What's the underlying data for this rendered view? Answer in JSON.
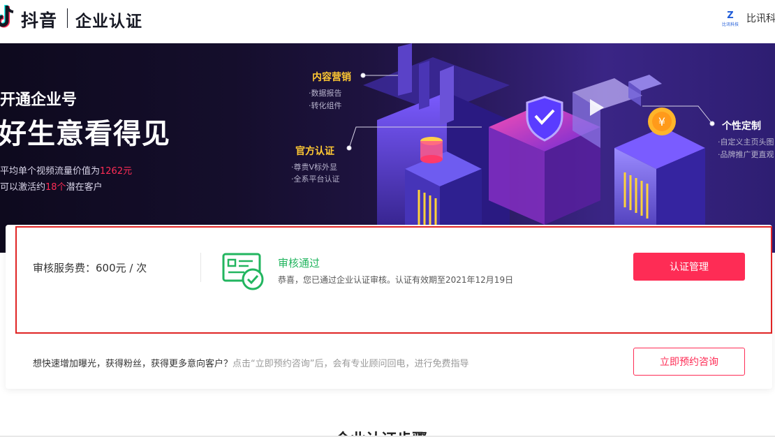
{
  "header": {
    "brand": "抖音",
    "subtitle": "企业认证",
    "company_name": "比讯科",
    "company_logo_text": "比讯科技"
  },
  "banner": {
    "title_small": "开通企业号",
    "title_large": "好生意看得见",
    "line1_prefix": "平均单个视频流量价值为",
    "line1_highlight": "1262元",
    "line2_prefix": "可以激活约",
    "line2_highlight": "18个",
    "line2_suffix": "潜在客户",
    "features": [
      {
        "title": "内容营销",
        "items": [
          "·数据报告",
          "·转化组件"
        ]
      },
      {
        "title": "官方认证",
        "items": [
          "·尊贵V标外显",
          "·全系平台认证"
        ]
      },
      {
        "title": "个性定制",
        "items": [
          "·自定义主页头图",
          "·品牌推广更直观"
        ]
      }
    ]
  },
  "status_card": {
    "fee_label": "审核服务费：600元 / 次",
    "status_title": "审核通过",
    "status_desc": "恭喜，您已通过企业认证审核。认证有效期至2021年12月19日",
    "manage_button": "认证管理"
  },
  "consult": {
    "text_main": "想快速增加曝光，获得粉丝，获得更多意向客户？",
    "text_hint": "点击“立即预约咨询”后，会有专业顾问回电，进行免费指导",
    "button": "立即预约咨询"
  },
  "steps": {
    "title": "企业认证步骤"
  },
  "colors": {
    "accent": "#fe2c55",
    "success": "#22b55f",
    "highlight_border": "#e02424",
    "feature_gold": "#ffc833",
    "banner_dark": "#120c26"
  }
}
